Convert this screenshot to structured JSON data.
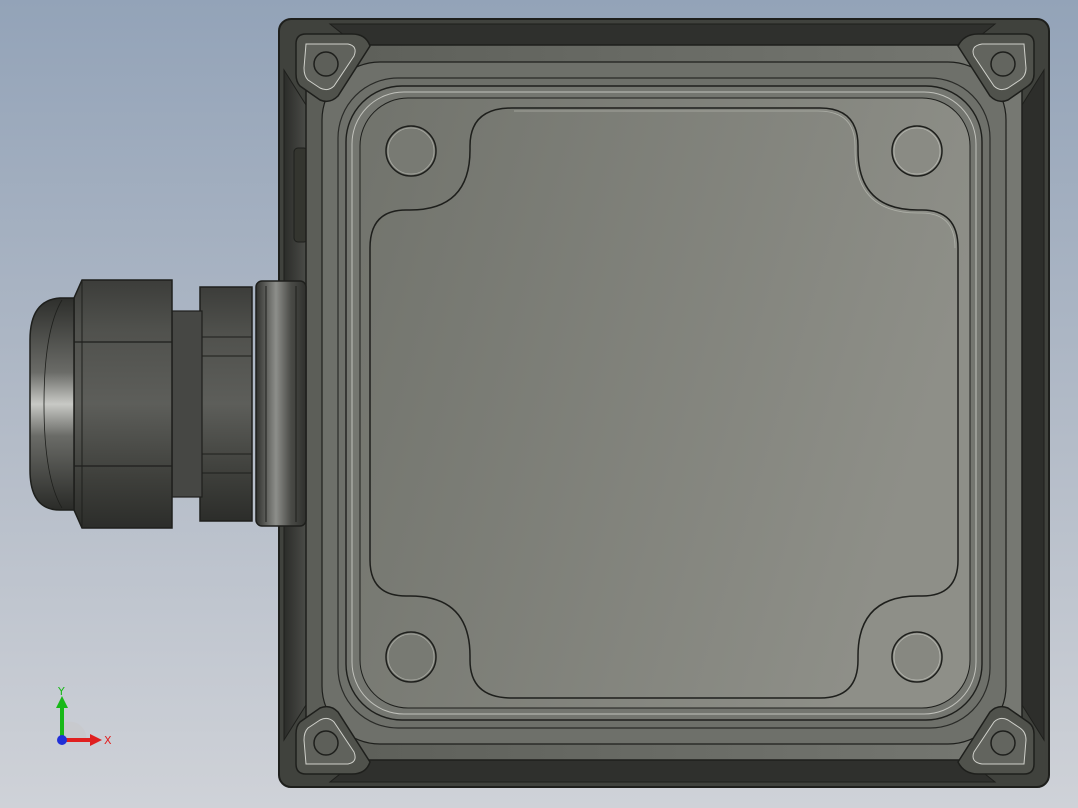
{
  "viewport": {
    "background_top": "#93a3b8",
    "background_bottom": "#cfd2d8"
  },
  "colors": {
    "body_dark": "#3e403b",
    "body_mid": "#6a6c66",
    "lid_light": "#8e8f88",
    "lid_dark": "#71736c",
    "edge": "#1e1f1c",
    "gland_dark": "#3a3b38",
    "gland_light": "#9a9b97",
    "axis_x": "#e02020",
    "axis_y": "#18b818",
    "axis_z": "#2030d8"
  },
  "triad": {
    "x_label": "X",
    "y_label": "Y"
  },
  "icons": [
    "coordinate-triad-icon"
  ]
}
